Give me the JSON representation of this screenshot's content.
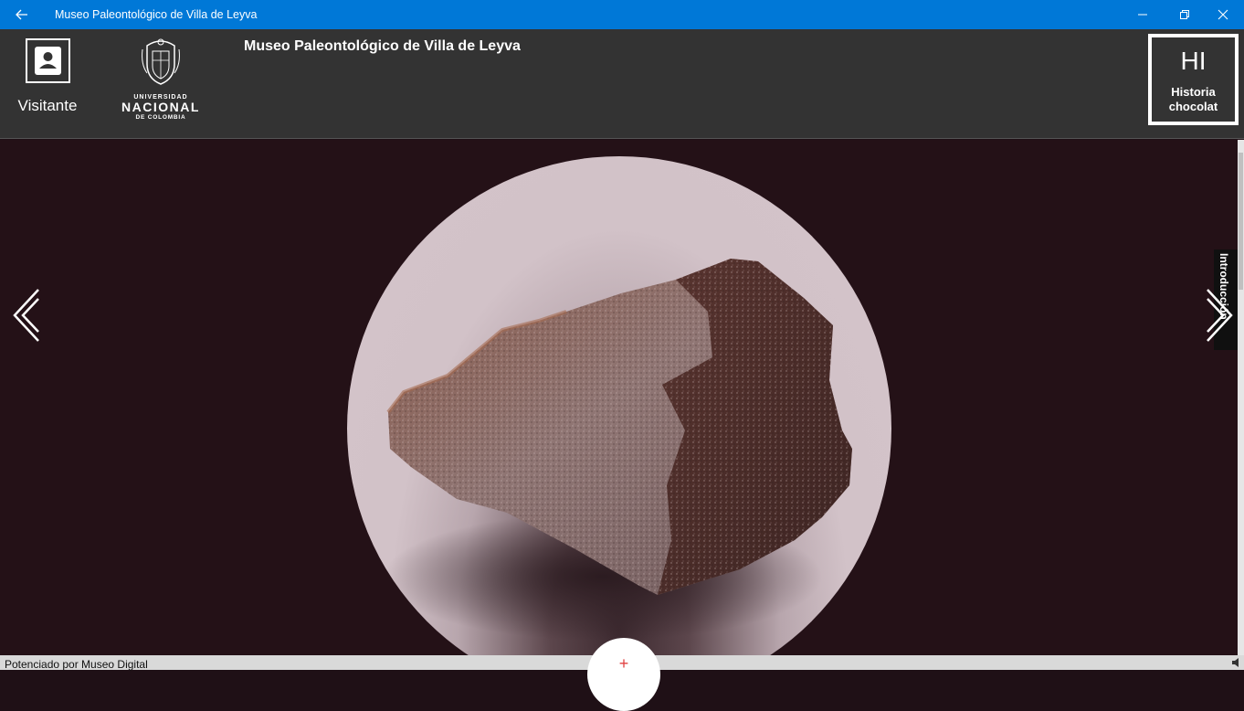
{
  "window": {
    "title": "Museo Paleontológico de Villa de Leyva",
    "back_icon": "arrow-left-icon",
    "controls": [
      "minimize-icon",
      "restore-icon",
      "close-icon"
    ],
    "accent": "#0078d7"
  },
  "header": {
    "user_label": "Visitante",
    "logo": {
      "line1": "UNIVERSIDAD",
      "line2": "NACIONAL",
      "line3": "DE COLOMBIA"
    },
    "museum_name": "Museo Paleontológico de Villa de Leyva",
    "tile": {
      "initials": "HI",
      "label": "Historia chocolat"
    }
  },
  "main": {
    "side_tab_label": "Introducción",
    "prev_icon": "chevron-double-left-icon",
    "next_icon": "chevron-double-right-icon",
    "exhibit_image": "rock-specimen"
  },
  "footer": {
    "powered_by": "Potenciado por Museo Digital",
    "add_button": "+",
    "speaker_icon": "speaker-icon"
  }
}
